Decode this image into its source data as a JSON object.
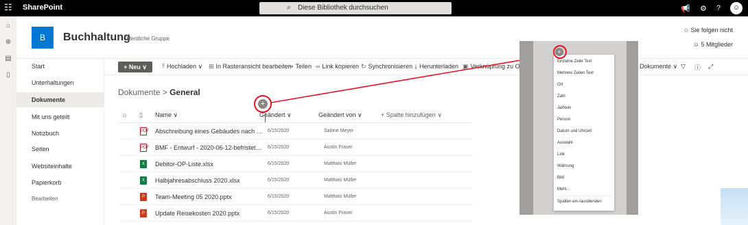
{
  "suitebar": {
    "app_name": "SharePoint",
    "search_placeholder": "Diese Bibliothek durchsuchen",
    "icons": [
      "waffle-icon",
      "megaphone-icon",
      "gear-icon",
      "help-icon",
      "avatar"
    ]
  },
  "site": {
    "logo_letter": "B",
    "title": "Buchhaltung",
    "subtitle": "Öffentliche Gruppe",
    "follow_label": "Sie folgen nicht",
    "members_label": "5 Mitglieder"
  },
  "nav": {
    "items": [
      {
        "label": "Start"
      },
      {
        "label": "Unterhaltungen"
      },
      {
        "label": "Dokumente"
      },
      {
        "label": "Mit uns geteilt"
      },
      {
        "label": "Notizbuch"
      },
      {
        "label": "Seiten"
      },
      {
        "label": "Websiteinhalte"
      },
      {
        "label": "Papierkorb"
      },
      {
        "label": "Bearbeiten"
      }
    ],
    "active": "Dokumente"
  },
  "commandbar": {
    "new_label": "Neu",
    "upload": "Hochladen",
    "grid_edit": "In Rasteransicht bearbeiten",
    "share": "Teilen",
    "copy_link": "Link kopieren",
    "sync": "Synchronisieren",
    "download": "Herunterladen",
    "shortcut": "Verknüpfung zu One",
    "view": "Dokumente"
  },
  "breadcrumb": {
    "root": "Dokumente",
    "separator": ">",
    "current": "General"
  },
  "table": {
    "headers": {
      "name": "Name",
      "modified": "Geändert",
      "modified_by": "Geändert von",
      "add_column": "+ Spalte hinzufügen"
    },
    "rows": [
      {
        "name": "Abschreibung eines Gebäudes nach kürzere...",
        "date": "6/15/2020",
        "by": "Sabine Meyer",
        "type": "pdf"
      },
      {
        "name": "BMF - Entwurf - 2020-06-12-befristete-Sen...",
        "date": "6/15/2020",
        "by": "Austin Fraser",
        "type": "pdf"
      },
      {
        "name": "Debitor-OP-Liste.xlsx",
        "date": "6/15/2020",
        "by": "Matthias Müller",
        "type": "xlsx"
      },
      {
        "name": "Halbjahresabschluss 2020.xlsx",
        "date": "6/15/2020",
        "by": "Matthias Müller",
        "type": "xlsx"
      },
      {
        "name": "Team-Meeting 05 2020.pptx",
        "date": "6/15/2020",
        "by": "Matthias Müller",
        "type": "pptx"
      },
      {
        "name": "Update Reisekosten 2020.pptx",
        "date": "6/15/2020",
        "by": "Austin Fraser",
        "type": "pptx"
      }
    ]
  },
  "column_menu": {
    "items": [
      "Einzelne Zeile Text",
      "Mehrere Zeilen Text",
      "Ort",
      "Zahl",
      "Ja/Nein",
      "Person",
      "Datum und Uhrzeit",
      "Auswahl",
      "Link",
      "Währung",
      "Bild",
      "Mehr..."
    ],
    "footer": "Spalten ein-/ausblenden"
  },
  "colors": {
    "suitebar": "#000000",
    "accent": "#0078d4",
    "highlight": "#e81123"
  }
}
